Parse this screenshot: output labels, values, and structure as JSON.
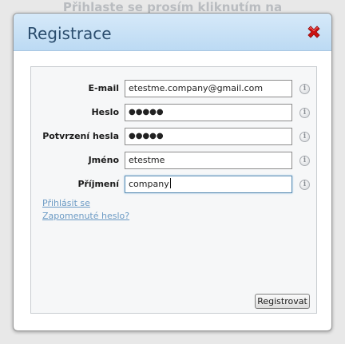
{
  "backdrop": {
    "text": "Přihlaste se prosím kliknutím na"
  },
  "dialog": {
    "title": "Registrace",
    "close_icon": "close-icon",
    "fields": [
      {
        "label": "E-mail",
        "value": "etestme.company@gmail.com",
        "type": "text"
      },
      {
        "label": "Heslo",
        "value": "●●●●●",
        "type": "password"
      },
      {
        "label": "Potvrzení hesla",
        "value": "●●●●●",
        "type": "password"
      },
      {
        "label": "Jméno",
        "value": "etestme",
        "type": "text"
      },
      {
        "label": "Příjmení",
        "value": "company",
        "type": "text",
        "focused": true
      }
    ],
    "info_icon": "i",
    "links": {
      "login": "Přihlásit se",
      "forgot": "Zapomenuté heslo?"
    },
    "submit_label": "Registrovat"
  },
  "colors": {
    "header_gradient_top": "#d6e9f9",
    "header_gradient_bottom": "#bcdaf3",
    "title": "#2b4d6e",
    "close": "#cc1111",
    "link": "#6b9ac4"
  }
}
